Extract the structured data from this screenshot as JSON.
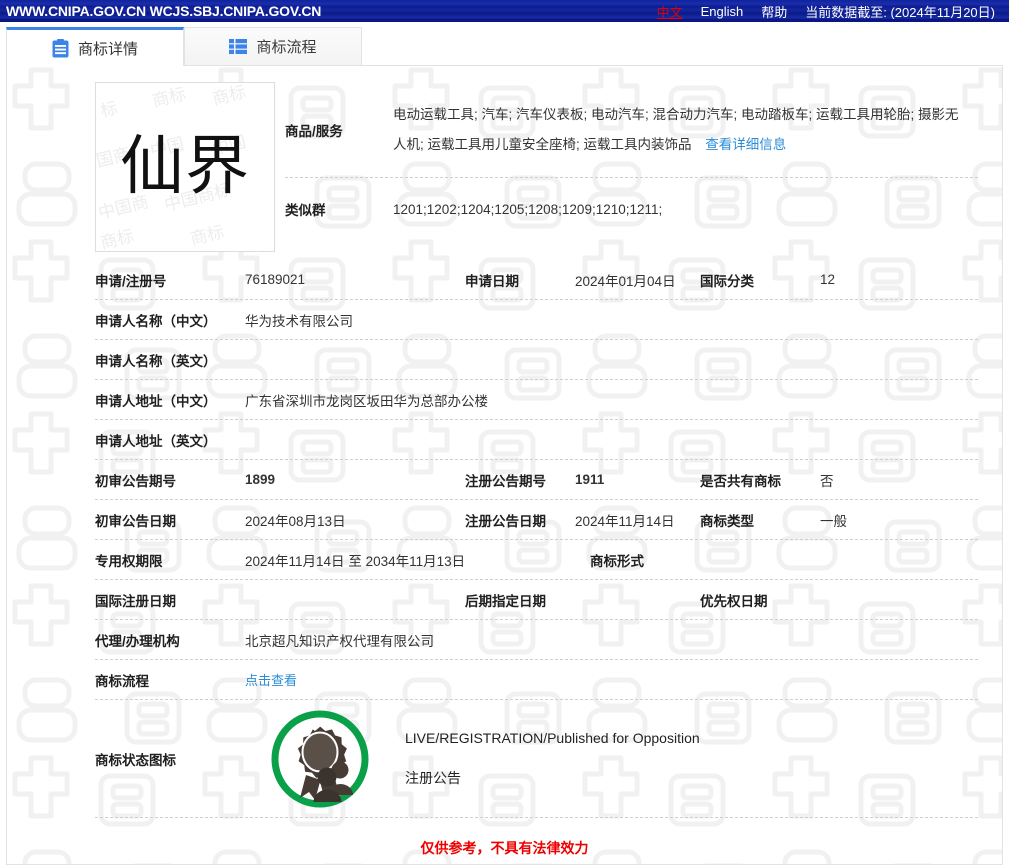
{
  "topbar": {
    "site_urls": "WWW.CNIPA.GOV.CN  WCJS.SBJ.CNIPA.GOV.CN",
    "lang_zh": "中文",
    "lang_en": "English",
    "help": "帮助",
    "data_cutoff": "当前数据截至: (2024年11月20日)"
  },
  "tabs": [
    {
      "label": "商标详情",
      "icon": "clipboard-icon",
      "active": true
    },
    {
      "label": "商标流程",
      "icon": "list-grid-icon",
      "active": false
    }
  ],
  "mark": {
    "text": "仙界",
    "watermark": "中国商标"
  },
  "goods": {
    "label": "商品/服务",
    "text": "电动运载工具; 汽车; 汽车仪表板; 电动汽车; 混合动力汽车; 电动踏板车; 运载工具用轮胎; 摄影无人机; 运载工具用儿童安全座椅; 运载工具内装饰品",
    "detail_link": "查看详细信息"
  },
  "similar_groups": {
    "label": "类似群",
    "value": "1201;1202;1204;1205;1208;1209;1210;1211;"
  },
  "fields": {
    "app_no_label": "申请/注册号",
    "app_no_value": "76189021",
    "app_date_label": "申请日期",
    "app_date_value": "2024年01月04日",
    "intl_class_label": "国际分类",
    "intl_class_value": "12",
    "applicant_cn_label": "申请人名称（中文）",
    "applicant_cn_value": "华为技术有限公司",
    "applicant_en_label": "申请人名称（英文）",
    "applicant_en_value": "",
    "address_cn_label": "申请人地址（中文）",
    "address_cn_value": "广东省深圳市龙岗区坂田华为总部办公楼",
    "address_en_label": "申请人地址（英文）",
    "address_en_value": "",
    "prelim_issue_label": "初审公告期号",
    "prelim_issue_value": "1899",
    "reg_issue_label": "注册公告期号",
    "reg_issue_value": "1911",
    "shared_label": "是否共有商标",
    "shared_value": "否",
    "prelim_date_label": "初审公告日期",
    "prelim_date_value": "2024年08月13日",
    "reg_date_label": "注册公告日期",
    "reg_date_value": "2024年11月14日",
    "mark_type_label": "商标类型",
    "mark_type_value": "一般",
    "exclusive_label": "专用权期限",
    "exclusive_value": "2024年11月14日 至 2034年11月13日",
    "mark_form_label": "商标形式",
    "mark_form_value": "",
    "intl_reg_date_label": "国际注册日期",
    "intl_reg_date_value": "",
    "subsequent_date_label": "后期指定日期",
    "subsequent_date_value": "",
    "priority_date_label": "优先权日期",
    "priority_date_value": "",
    "agent_label": "代理/办理机构",
    "agent_value": "北京超凡知识产权代理有限公司",
    "process_label": "商标流程",
    "process_link": "点击查看",
    "status_label": "商标状态图标",
    "status_text_en": "LIVE/REGISTRATION/Published for Opposition",
    "status_text_cn": "注册公告"
  },
  "disclaimer": "仅供参考，不具有法律效力",
  "colors": {
    "topbar_blue": "#11229b",
    "accent_blue": "#3c84e8",
    "link_blue": "#2a8cd8",
    "status_green": "#0aa04a",
    "alert_red": "#ee0000"
  }
}
